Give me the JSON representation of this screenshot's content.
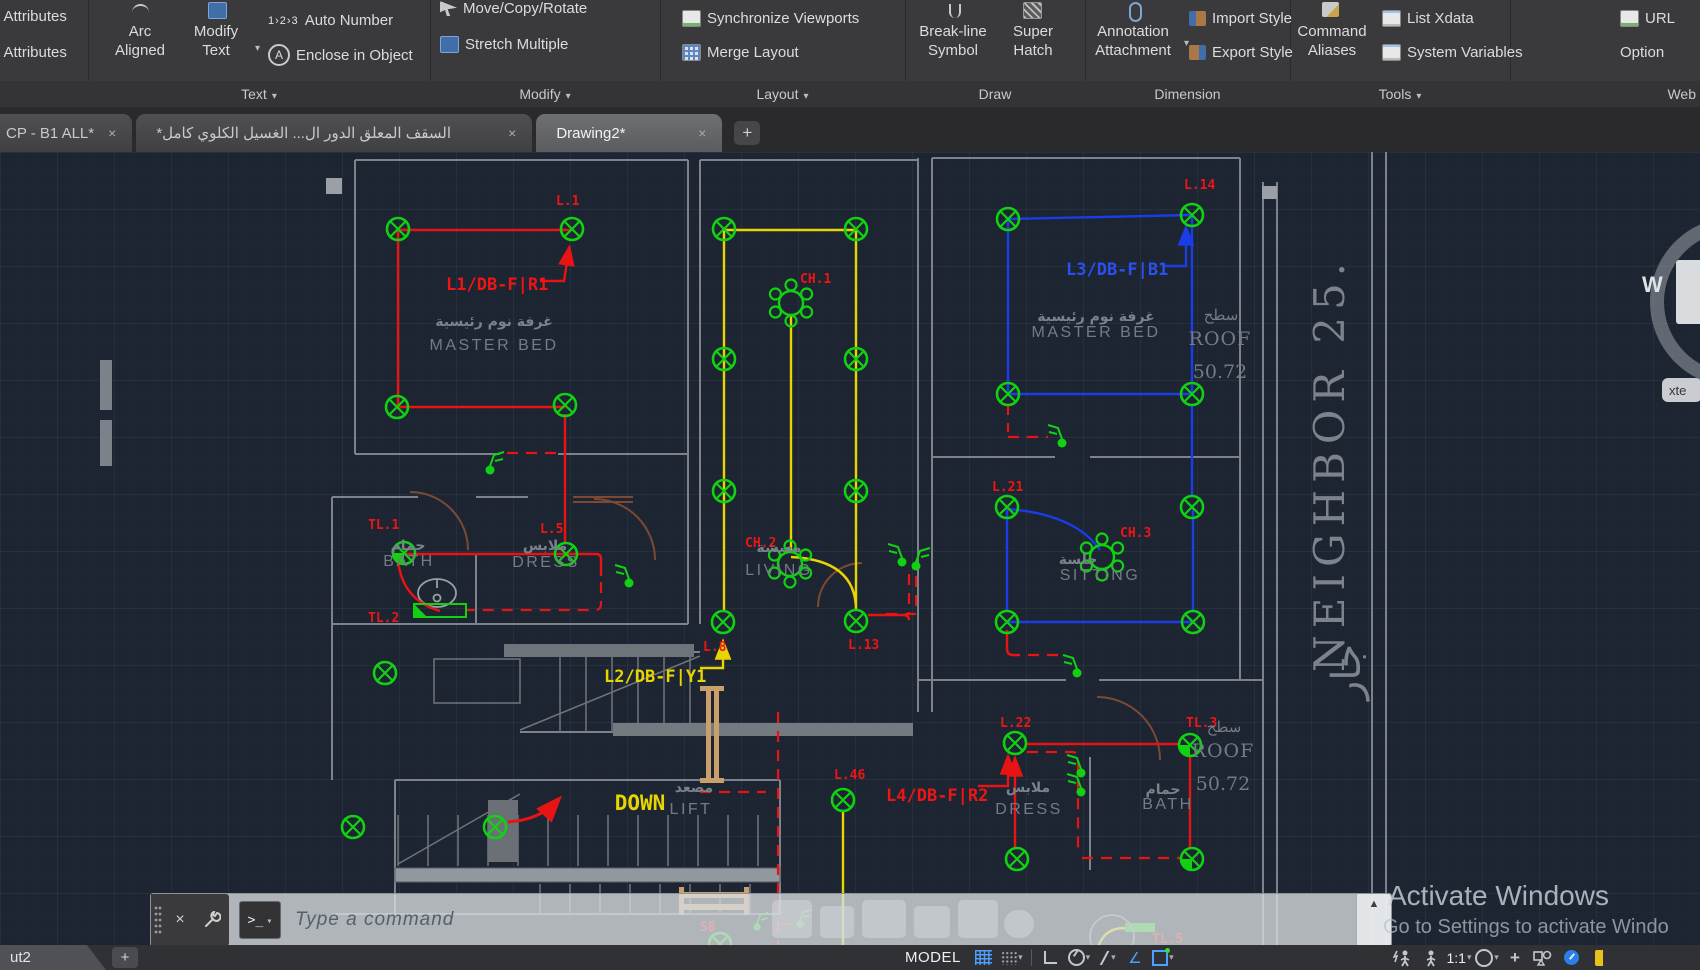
{
  "ribbon": {
    "attributes_panel": {
      "item1": "t Attributes",
      "item2": "t Attributes"
    },
    "text_panel": {
      "label": "Text",
      "arc_aligned_l1": "Arc",
      "arc_aligned_l2": "Aligned",
      "modify_text_l1": "Modify",
      "modify_text_l2": "Text",
      "auto_number": "Auto Number",
      "auto_number_glyph": "1›2›3",
      "enclose_in_object": "Enclose in Object",
      "enclose_glyph": "A"
    },
    "modify_panel": {
      "label": "Modify",
      "move_copy_rotate": "Move/Copy/Rotate",
      "stretch_multiple": "Stretch Multiple"
    },
    "layout_panel": {
      "label": "Layout",
      "synchronize_viewports": "Synchronize Viewports",
      "merge_layout": "Merge Layout"
    },
    "draw_panel": {
      "label": "Draw",
      "breakline_l1": "Break-line",
      "breakline_l2": "Symbol",
      "superhatch_l1": "Super",
      "superhatch_l2": "Hatch"
    },
    "dimension_panel": {
      "label": "Dimension",
      "annotation_l1": "Annotation",
      "annotation_l2": "Attachment",
      "import_style": "Import Style",
      "export_style": "Export Style"
    },
    "tools_panel": {
      "label": "Tools",
      "command_l1": "Command",
      "command_l2": "Aliases",
      "list_xdata": "List Xdata",
      "system_variables": "System Variables"
    },
    "web_panel": {
      "label": "Web",
      "url": "URL",
      "option": "Option"
    }
  },
  "doc_tabs": {
    "tab1": "CP - B1 ALL*",
    "tab2": "السقف المعلق الدور ال... الغسيل الكلوي كامل*",
    "tab3": "Drawing2*",
    "close_glyph": "×",
    "new_tab_glyph": "+"
  },
  "command_bar": {
    "close_glyph": "×",
    "prompt_glyph": ">_",
    "placeholder": "Type  a  command"
  },
  "status_bar": {
    "layout_tab": "ut2",
    "new_layout_glyph": "+",
    "model": "MODEL",
    "annotation_scale": "1:1"
  },
  "activate": {
    "line1": "Activate Windows",
    "line2": "Go to Settings to activate Windo"
  },
  "plan": {
    "circuit_labels": {
      "l1": "L.1",
      "l1_run": "L1/DB-F|R1",
      "ch1": "CH.1",
      "ch2": "CH.2",
      "ch3": "CH.3",
      "l14": "L.14",
      "l3_run": "L3/DB-F|B1",
      "tl1": "TL.1",
      "l5": "L.5",
      "tl2": "TL.2",
      "l21": "L.21",
      "l13": "L.13",
      "l8": "L.8",
      "l2_run": "L2/DB-F|Y1",
      "l22": "L.22",
      "tl3": "TL.3",
      "l46": "L.46",
      "l4_run": "L4/DB-F|R2",
      "s8": "S8",
      "tl5": "TL.5"
    },
    "rooms": {
      "master_bed_ar": "غرفة نوم رئيسية",
      "master_bed_en": "MASTER BED",
      "living_ar": "معيشة",
      "living_en": "LIVING",
      "sitting_ar": "جلسة",
      "sitting_en": "SITTING",
      "bath_ar": "حمام",
      "bath_en": "BATH",
      "dress_ar": "ملابس",
      "dress_en": "DRESS",
      "lift_ar": "مصعد",
      "lift_en": "LIFT",
      "down": "DOWN",
      "roof_ar": "سطح",
      "roof_en": "ROOF",
      "roof_level": "50.72",
      "neighbor": "NEIGHBOR 25.",
      "neighbor_ar": "جار"
    },
    "viewcube_w": "W",
    "xte_chip": "xte"
  },
  "colors": {
    "wire_red": "#e81414",
    "wire_yellow": "#e8d400",
    "wire_blue": "#1a3de8",
    "symbol_green": "#12d112",
    "wall_gray": "#858a92",
    "door_brown": "#7c4a33",
    "room_text": "#747b86",
    "canvas_bg": "#1c2531",
    "accent_blue": "#4da0ff"
  }
}
